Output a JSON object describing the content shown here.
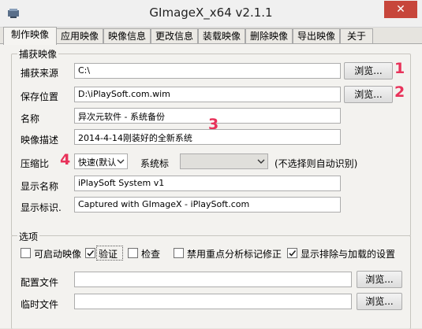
{
  "window": {
    "title": "GImageX_x64 v2.1.1",
    "close_glyph": "✕"
  },
  "tabs": [
    "制作映像",
    "应用映像",
    "映像信息",
    "更改信息",
    "装载映像",
    "删除映像",
    "导出映像",
    "关于"
  ],
  "capture_group": {
    "title": "捕获映像",
    "source_label": "捕获来源",
    "source_value": "C:\\",
    "save_label": "保存位置",
    "save_value": "D:\\iPlaySoft.com.wim",
    "name_label": "名称",
    "name_value": "异次元软件 - 系统备份",
    "desc_label": "映像描述",
    "desc_value": "2014-4-14刚装好的全新系统",
    "compress_label": "压缩比",
    "compress_value": "快速(默认",
    "flag_label": "系统标",
    "flag_value": "",
    "flag_hint": "(不选择则自动识别)",
    "display_name_label": "显示名称",
    "display_name_value": "iPlaySoft System v1",
    "display_flag_label": "显示标识.",
    "display_flag_value": "Captured with GImageX - iPlaySoft.com",
    "browse_label": "浏览..."
  },
  "callouts": [
    "1",
    "2",
    "3",
    "4"
  ],
  "options_group": {
    "title": "选项",
    "checkboxes": [
      {
        "label": "可启动映像",
        "checked": false
      },
      {
        "label": "验证",
        "checked": true
      },
      {
        "label": "检查",
        "checked": false
      },
      {
        "label": "禁用重点分析标记修正",
        "checked": false
      },
      {
        "label": "显示排除与加载的设置",
        "checked": true
      }
    ],
    "config_label": "配置文件",
    "temp_label": "临时文件",
    "browse_label": "浏览..."
  },
  "colors": {
    "callout": "#e8325a",
    "close": "#c7463b"
  }
}
